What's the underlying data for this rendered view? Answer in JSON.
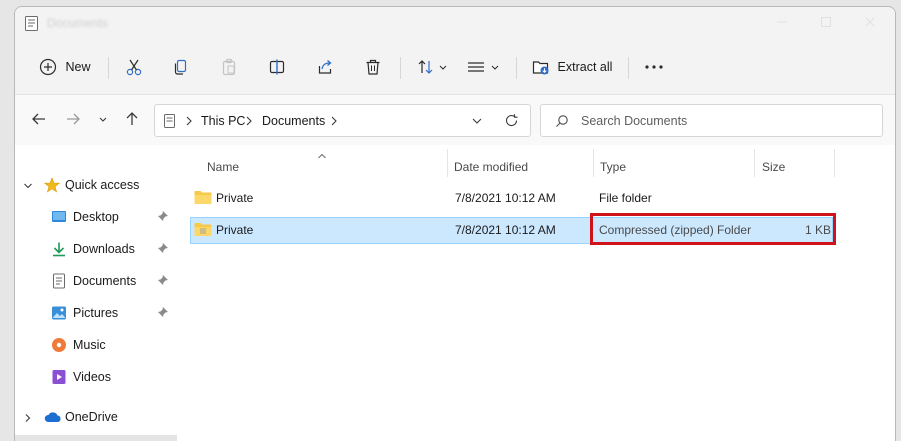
{
  "window": {
    "title": "Documents"
  },
  "toolbar": {
    "new_label": "New",
    "extract_label": "Extract all",
    "icons": [
      "new-icon",
      "cut-icon",
      "copy-icon",
      "paste-icon",
      "rename-icon",
      "share-icon",
      "delete-icon",
      "sort-icon",
      "view-icon",
      "extract-icon",
      "more-icon"
    ]
  },
  "address": {
    "crumbs": [
      "This PC",
      "Documents"
    ],
    "search_placeholder": "Search Documents"
  },
  "nav": {
    "quick_access": "Quick access",
    "items": [
      {
        "label": "Desktop",
        "icon": "desktop-icon",
        "pinned": true
      },
      {
        "label": "Downloads",
        "icon": "downloads-icon",
        "pinned": true
      },
      {
        "label": "Documents",
        "icon": "documents-icon",
        "pinned": true
      },
      {
        "label": "Pictures",
        "icon": "pictures-icon",
        "pinned": true
      },
      {
        "label": "Music",
        "icon": "music-icon",
        "pinned": false
      },
      {
        "label": "Videos",
        "icon": "videos-icon",
        "pinned": false
      }
    ],
    "onedrive": "OneDrive"
  },
  "columns": {
    "name": "Name",
    "date": "Date modified",
    "type": "Type",
    "size": "Size"
  },
  "files": [
    {
      "name": "Private",
      "date": "7/8/2021 10:12 AM",
      "type": "File folder",
      "size": "",
      "kind": "folder"
    },
    {
      "name": "Private",
      "date": "7/8/2021 10:12 AM",
      "type": "Compressed (zipped) Folder",
      "size": "1 KB",
      "kind": "zip"
    }
  ],
  "colors": {
    "selection_bg": "#cce8ff",
    "selection_border": "#99d1ff",
    "highlight": "#d0121b",
    "folder": "#f7c948"
  }
}
